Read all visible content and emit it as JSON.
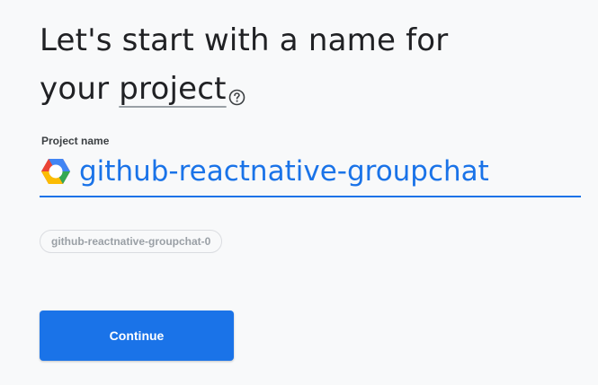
{
  "header": {
    "title_line1": "Let's start with a name for",
    "title_line2_prefix": "your ",
    "title_line2_link": "project",
    "help_icon": "help-circle-icon"
  },
  "form": {
    "project_name_label": "Project name",
    "project_name_value": "github-reactnative-groupchat",
    "logo_icon": "google-cloud-logo-icon",
    "project_id": "github-reactnative-groupchat-0"
  },
  "actions": {
    "continue_label": "Continue"
  },
  "colors": {
    "accent": "#1a73e8",
    "background": "#f8f9fa",
    "text": "#202124"
  }
}
